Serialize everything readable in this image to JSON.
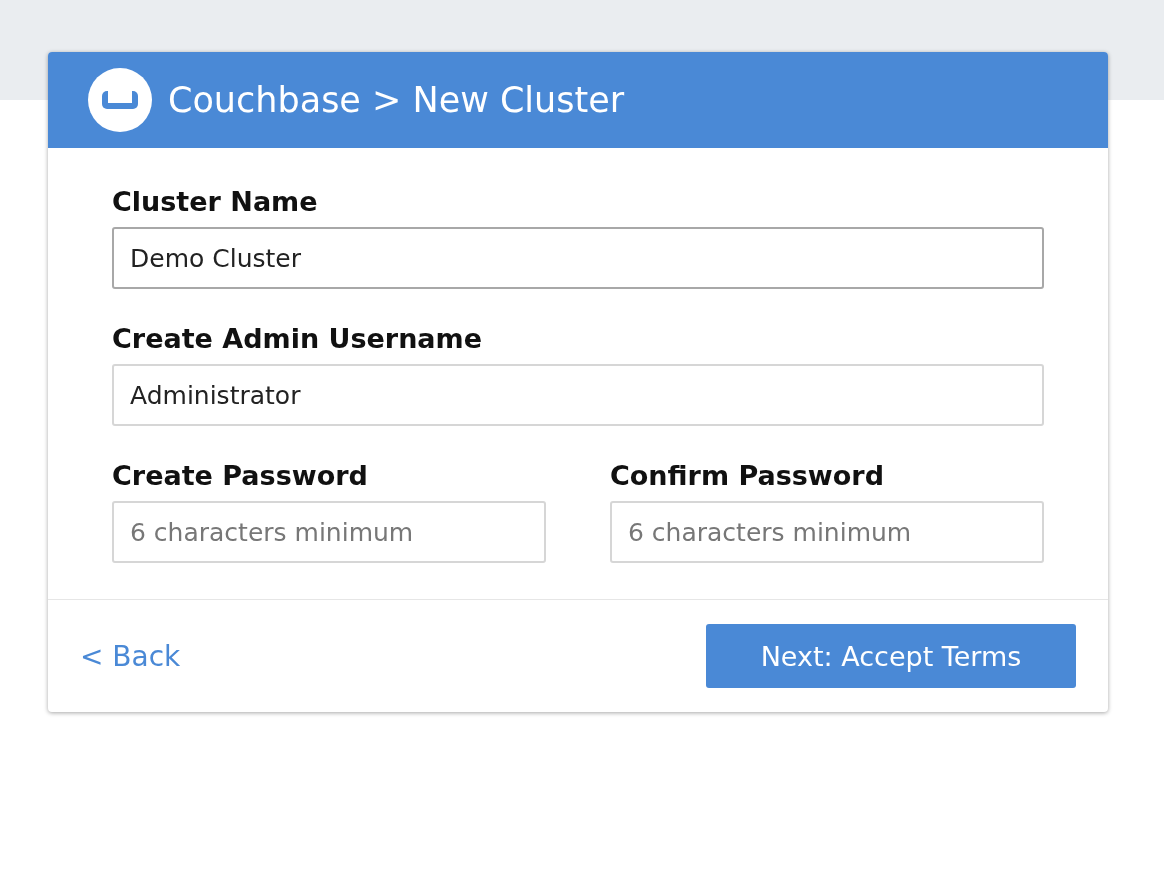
{
  "header": {
    "title": "Couchbase > New Cluster"
  },
  "rows": [
    [
      {
        "label": "Cluster Name",
        "value": "Demo Cluster",
        "focused": true
      }
    ],
    [
      {
        "label": "Create Admin Username",
        "value": "Administrator",
        "focused": false
      }
    ],
    [
      {
        "label": "Create Password",
        "placeholder": "6 characters minimum",
        "focused": false
      },
      {
        "label": "Confirm Password",
        "placeholder": "6 characters minimum",
        "focused": false
      }
    ]
  ],
  "footer": {
    "back": "< Back",
    "next": "Next: Accept Terms"
  }
}
